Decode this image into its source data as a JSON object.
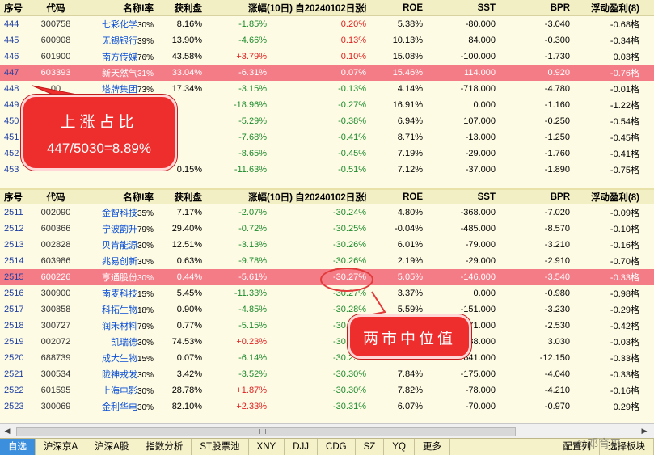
{
  "columns": {
    "no": "序号",
    "code": "代码",
    "name": "名称I率",
    "profit": "获利盘",
    "chg": "涨幅",
    "ten_day": "(10日) 自20240102日涨幅",
    "ten_day_icon": "↓",
    "roe": "ROE",
    "sst": "SST",
    "bpr": "BPR",
    "float": "浮动盈利(8)"
  },
  "top_rows": [
    {
      "no": "444",
      "code": "300758",
      "name": "七彩化学",
      "suf": "30%",
      "profit": "8.16%",
      "chg": "-1.85%",
      "ten": "0.20%",
      "roe": "5.38%",
      "sst": "-80.000",
      "bpr": "-3.040",
      "flt": "-0.68格",
      "chg_color": "green",
      "ten_color": "red"
    },
    {
      "no": "445",
      "code": "600908",
      "name": "无锡银行",
      "suf": "39%",
      "profit": "13.90%",
      "chg": "-4.66%",
      "ten": "0.13%",
      "roe": "10.13%",
      "sst": "84.000",
      "bpr": "-0.300",
      "flt": "-0.34格",
      "chg_color": "green",
      "ten_color": "red"
    },
    {
      "no": "446",
      "code": "601900",
      "name": "南方传媒",
      "suf": "76%",
      "profit": "43.58%",
      "chg": "+3.79%",
      "ten": "0.10%",
      "roe": "15.08%",
      "sst": "-100.000",
      "bpr": "-1.730",
      "flt": "0.03格",
      "chg_color": "red",
      "ten_color": "red"
    },
    {
      "no": "447",
      "code": "603393",
      "name": "新天然气",
      "suf": "31%",
      "profit": "33.04%",
      "chg": "-6.31%",
      "ten": "0.07%",
      "roe": "15.46%",
      "sst": "114.000",
      "bpr": "0.920",
      "flt": "-0.76格",
      "chg_color": "green",
      "ten_color": "red",
      "hl": true
    },
    {
      "no": "448",
      "code": "00",
      "name": "塔牌集团",
      "suf": "73%",
      "profit": "17.34%",
      "chg": "-3.15%",
      "ten": "-0.13%",
      "roe": "4.14%",
      "sst": "-718.000",
      "bpr": "-4.780",
      "flt": "-0.01格",
      "chg_color": "green",
      "ten_color": "green"
    },
    {
      "no": "449",
      "code": "",
      "name": "",
      "suf": "88%",
      "profit": "",
      "chg": "-18.96%",
      "ten": "-0.27%",
      "roe": "16.91%",
      "sst": "0.000",
      "bpr": "-1.160",
      "flt": "-1.22格",
      "chg_color": "green",
      "ten_color": "green"
    },
    {
      "no": "450",
      "code": "",
      "name": "",
      "suf": "76%",
      "profit": "",
      "chg": "-5.29%",
      "ten": "-0.38%",
      "roe": "6.94%",
      "sst": "107.000",
      "bpr": "-0.250",
      "flt": "-0.54格",
      "chg_color": "green",
      "ten_color": "green"
    },
    {
      "no": "451",
      "code": "",
      "name": "",
      "suf": "79%",
      "profit": "",
      "chg": "-7.68%",
      "ten": "-0.41%",
      "roe": "8.71%",
      "sst": "-13.000",
      "bpr": "-1.250",
      "flt": "-0.45格",
      "chg_color": "green",
      "ten_color": "green"
    },
    {
      "no": "452",
      "code": "",
      "name": "",
      "suf": "98%",
      "profit": "",
      "chg": "-8.65%",
      "ten": "-0.45%",
      "roe": "7.19%",
      "sst": "-29.000",
      "bpr": "-1.760",
      "flt": "-0.41格",
      "chg_color": "green",
      "ten_color": "green"
    },
    {
      "no": "453",
      "code": "",
      "name": "",
      "suf": "",
      "profit": "0.15%",
      "chg": "-11.63%",
      "ten": "-0.51%",
      "roe": "7.12%",
      "sst": "-37.000",
      "bpr": "-1.890",
      "flt": "-0.75格",
      "chg_color": "green",
      "ten_color": "green"
    }
  ],
  "bottom_rows": [
    {
      "no": "2511",
      "code": "002090",
      "name": "金智科技",
      "suf": "35%",
      "profit": "7.17%",
      "chg": "-2.07%",
      "ten": "-30.24%",
      "roe": "4.80%",
      "sst": "-368.000",
      "bpr": "-7.020",
      "flt": "-0.09格",
      "chg_color": "green",
      "ten_color": "green"
    },
    {
      "no": "2512",
      "code": "600366",
      "name": "宁波韵升",
      "suf": "79%",
      "profit": "29.40%",
      "chg": "-0.72%",
      "ten": "-30.25%",
      "roe": "-0.04%",
      "sst": "-485.000",
      "bpr": "-8.570",
      "flt": "-0.10格",
      "chg_color": "green",
      "ten_color": "green"
    },
    {
      "no": "2513",
      "code": "002828",
      "name": "贝肯能源",
      "suf": "30%",
      "profit": "12.51%",
      "chg": "-3.13%",
      "ten": "-30.26%",
      "roe": "6.01%",
      "sst": "-79.000",
      "bpr": "-3.210",
      "flt": "-0.16格",
      "chg_color": "green",
      "ten_color": "green"
    },
    {
      "no": "2514",
      "code": "603986",
      "name": "兆易创新",
      "suf": "30%",
      "profit": "0.63%",
      "chg": "-9.78%",
      "ten": "-30.26%",
      "roe": "2.19%",
      "sst": "-29.000",
      "bpr": "-2.910",
      "flt": "-0.70格",
      "chg_color": "green",
      "ten_color": "green"
    },
    {
      "no": "2515",
      "code": "600226",
      "name": "亨通股份",
      "suf": "30%",
      "profit": "0.44%",
      "chg": "-5.61%",
      "ten": "-30.27%",
      "roe": "5.05%",
      "sst": "-146.000",
      "bpr": "-3.540",
      "flt": "-0.33格",
      "chg_color": "green",
      "ten_color": "green",
      "hl": true
    },
    {
      "no": "2516",
      "code": "300900",
      "name": "南麦科技",
      "suf": "15%",
      "profit": "5.45%",
      "chg": "-11.33%",
      "ten": "-30.27%",
      "roe": "3.37%",
      "sst": "0.000",
      "bpr": "-0.980",
      "flt": "-0.98格",
      "chg_color": "green",
      "ten_color": "green"
    },
    {
      "no": "2517",
      "code": "300858",
      "name": "科拓生物",
      "suf": "18%",
      "profit": "0.90%",
      "chg": "-4.85%",
      "ten": "-30.28%",
      "roe": "5.59%",
      "sst": "-151.000",
      "bpr": "-3.230",
      "flt": "-0.29格",
      "chg_color": "green",
      "ten_color": "green"
    },
    {
      "no": "2518",
      "code": "300727",
      "name": "润禾材料",
      "suf": "79%",
      "profit": "0.77%",
      "chg": "-5.15%",
      "ten": "-30.28%",
      "roe": "6.43%",
      "sst": "-171.000",
      "bpr": "-2.530",
      "flt": "-0.42格",
      "chg_color": "green",
      "ten_color": "green"
    },
    {
      "no": "2519",
      "code": "002072",
      "name": "凯瑞德",
      "suf": "30%",
      "profit": "74.53%",
      "chg": "+0.23%",
      "ten": "-30.28%",
      "roe": "-1.00%",
      "sst": "38.000",
      "bpr": "3.030",
      "flt": "-0.03格",
      "chg_color": "red",
      "ten_color": "green"
    },
    {
      "no": "2520",
      "code": "688739",
      "name": "成大生物",
      "suf": "15%",
      "profit": "0.07%",
      "chg": "-6.14%",
      "ten": "-30.29%",
      "roe": "4.52%",
      "sst": "-641.000",
      "bpr": "-12.150",
      "flt": "-0.33格",
      "chg_color": "green",
      "ten_color": "green"
    },
    {
      "no": "2521",
      "code": "300534",
      "name": "陇神戎发",
      "suf": "30%",
      "profit": "3.42%",
      "chg": "-3.52%",
      "ten": "-30.30%",
      "roe": "7.84%",
      "sst": "-175.000",
      "bpr": "-4.040",
      "flt": "-0.33格",
      "chg_color": "green",
      "ten_color": "green"
    },
    {
      "no": "2522",
      "code": "601595",
      "name": "上海电影",
      "suf": "30%",
      "profit": "28.78%",
      "chg": "+1.87%",
      "ten": "-30.30%",
      "roe": "7.82%",
      "sst": "-78.000",
      "bpr": "-4.210",
      "flt": "-0.16格",
      "chg_color": "red",
      "ten_color": "green"
    },
    {
      "no": "2523",
      "code": "300069",
      "name": "金利华电",
      "suf": "30%",
      "profit": "82.10%",
      "chg": "+2.33%",
      "ten": "-30.31%",
      "roe": "6.07%",
      "sst": "-70.000",
      "bpr": "-0.970",
      "flt": "0.29格",
      "chg_color": "red",
      "ten_color": "green"
    }
  ],
  "callout_up": {
    "line1": "上涨占比",
    "line2": "447/5030=8.89%"
  },
  "callout_median": {
    "text": "两市中位值"
  },
  "tabs": [
    "自选",
    "沪深京A",
    "沪深A股",
    "指数分析",
    "ST股票池",
    "XNY",
    "DJJ",
    "CDG",
    "SZ",
    "YQ",
    "更多"
  ],
  "tabs_right": [
    "配置列",
    "选择板块"
  ],
  "watermark": "@邓育平",
  "colors": {
    "highlight_row": "#f47c87",
    "callout": "#ee2d2d",
    "active_tab": "#3c8fdc",
    "background": "#fdfbe4"
  }
}
